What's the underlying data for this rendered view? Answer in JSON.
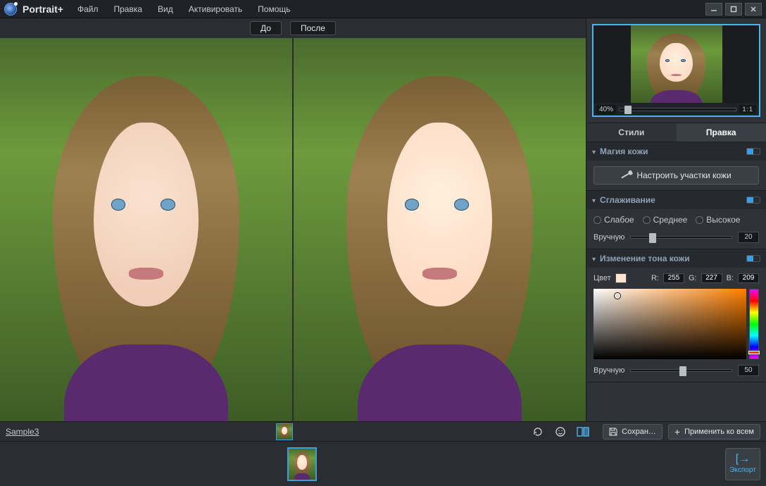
{
  "app": {
    "title": "Portrait+"
  },
  "menu": {
    "file": "Файл",
    "edit": "Правка",
    "view": "Вид",
    "activate": "Активировать",
    "help": "Помощь"
  },
  "compare": {
    "before": "До",
    "after": "После"
  },
  "preview": {
    "zoom": "40%",
    "oneToOne": "1:1"
  },
  "tabs": {
    "styles": "Стили",
    "edit": "Правка"
  },
  "skinMagic": {
    "title": "Магия кожи",
    "adjustAreas": "Настроить участки кожи"
  },
  "smoothing": {
    "title": "Сглаживание",
    "low": "Слабое",
    "medium": "Среднее",
    "high": "Высокое",
    "manualLabel": "Вручную",
    "manualValue": "20",
    "thumbPct": 18
  },
  "skinTone": {
    "title": "Изменение тона кожи",
    "colorLabel": "Цвет",
    "rLabel": "R:",
    "gLabel": "G:",
    "bLabel": "B:",
    "r": "255",
    "g": "227",
    "b": "209",
    "manualLabel": "Вручную",
    "manualValue": "50",
    "thumbPct": 48
  },
  "status": {
    "sampleName": "Sample3",
    "save": "Сохран…",
    "applyAll": "Применить ко всем"
  },
  "export": {
    "label": "Экспорт"
  }
}
